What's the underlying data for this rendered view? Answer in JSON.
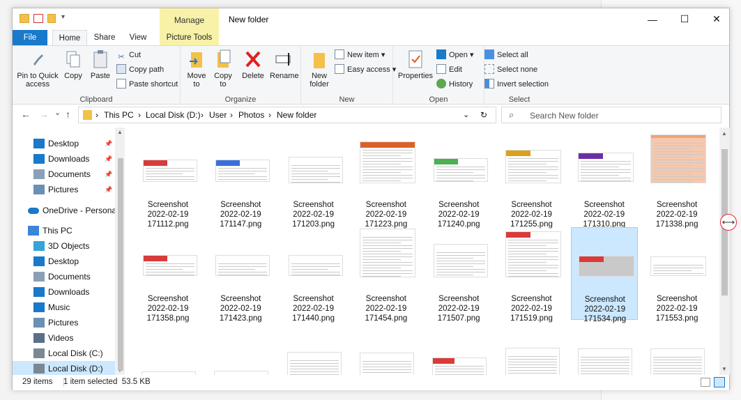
{
  "window": {
    "title": "New folder",
    "context_tab_group": "Manage",
    "minimize_glyph": "—",
    "maximize_glyph": "☐",
    "close_glyph": "✕"
  },
  "tabs": {
    "file": "File",
    "home": "Home",
    "share": "Share",
    "view": "View",
    "picture_tools": "Picture Tools"
  },
  "ribbon": {
    "clipboard": {
      "pin": "Pin to Quick access",
      "copy": "Copy",
      "paste": "Paste",
      "cut": "Cut",
      "copy_path": "Copy path",
      "paste_shortcut": "Paste shortcut",
      "label": "Clipboard"
    },
    "organize": {
      "move_to": "Move to",
      "copy_to": "Copy to",
      "delete": "Delete",
      "rename": "Rename",
      "label": "Organize"
    },
    "new": {
      "new_folder": "New folder",
      "new_item": "New item",
      "easy_access": "Easy access",
      "label": "New"
    },
    "open": {
      "properties": "Properties",
      "open": "Open",
      "edit": "Edit",
      "history": "History",
      "label": "Open"
    },
    "select": {
      "select_all": "Select all",
      "select_none": "Select none",
      "invert": "Invert selection",
      "label": "Select"
    }
  },
  "address": {
    "crumbs": [
      "This PC",
      "Local Disk (D:)",
      "User",
      "Photos",
      "New folder"
    ],
    "search_placeholder": "Search New folder"
  },
  "nav": {
    "items": [
      {
        "label": "Desktop",
        "icon": "desktop-icon",
        "pinned": true
      },
      {
        "label": "Downloads",
        "icon": "downloads-icon",
        "pinned": true
      },
      {
        "label": "Documents",
        "icon": "documents-icon",
        "pinned": true
      },
      {
        "label": "Pictures",
        "icon": "pictures-icon",
        "pinned": true
      },
      {
        "label": "OneDrive - Personal",
        "icon": "onedrive-icon",
        "pinned": false
      },
      {
        "label": "This PC",
        "icon": "this-pc-icon",
        "pinned": false
      },
      {
        "label": "3D Objects",
        "icon": "3d-objects-icon",
        "pinned": false
      },
      {
        "label": "Desktop",
        "icon": "desktop-icon",
        "pinned": false
      },
      {
        "label": "Documents",
        "icon": "documents-icon",
        "pinned": false
      },
      {
        "label": "Downloads",
        "icon": "downloads-icon",
        "pinned": false
      },
      {
        "label": "Music",
        "icon": "music-icon",
        "pinned": false
      },
      {
        "label": "Pictures",
        "icon": "pictures-icon",
        "pinned": false
      },
      {
        "label": "Videos",
        "icon": "videos-icon",
        "pinned": false
      },
      {
        "label": "Local Disk (C:)",
        "icon": "drive-icon",
        "pinned": false
      },
      {
        "label": "Local Disk (D:)",
        "icon": "drive-icon",
        "pinned": false,
        "selected": true
      }
    ]
  },
  "files": [
    {
      "name": "Screenshot",
      "date": "2022-02-19",
      "time": "171112.png",
      "accent": "#d93a3a"
    },
    {
      "name": "Screenshot",
      "date": "2022-02-19",
      "time": "171147.png",
      "accent": "#3a6fd9"
    },
    {
      "name": "Screenshot",
      "date": "2022-02-19",
      "time": "171203.png",
      "accent": ""
    },
    {
      "name": "Screenshot",
      "date": "2022-02-19",
      "time": "171223.png",
      "accent": "#d9622a"
    },
    {
      "name": "Screenshot",
      "date": "2022-02-19",
      "time": "171240.png",
      "accent": "#4caf50"
    },
    {
      "name": "Screenshot",
      "date": "2022-02-19",
      "time": "171255.png",
      "accent": "#d9a21a"
    },
    {
      "name": "Screenshot",
      "date": "2022-02-19",
      "time": "171310.png",
      "accent": "#6a2fa8"
    },
    {
      "name": "Screenshot",
      "date": "2022-02-19",
      "time": "171338.png",
      "accent": "#f0a276"
    },
    {
      "name": "Screenshot",
      "date": "2022-02-19",
      "time": "171358.png",
      "accent": "#d93a3a"
    },
    {
      "name": "Screenshot",
      "date": "2022-02-19",
      "time": "171423.png",
      "accent": ""
    },
    {
      "name": "Screenshot",
      "date": "2022-02-19",
      "time": "171440.png",
      "accent": ""
    },
    {
      "name": "Screenshot",
      "date": "2022-02-19",
      "time": "171454.png",
      "accent": ""
    },
    {
      "name": "Screenshot",
      "date": "2022-02-19",
      "time": "171507.png",
      "accent": ""
    },
    {
      "name": "Screenshot",
      "date": "2022-02-19",
      "time": "171519.png",
      "accent": "#d93a3a"
    },
    {
      "name": "Screenshot",
      "date": "2022-02-19",
      "time": "171534.png",
      "accent": "#d93a3a",
      "selected": true
    },
    {
      "name": "Screenshot",
      "date": "2022-02-19",
      "time": "171553.png",
      "accent": ""
    }
  ],
  "partial_row_count": 8,
  "status": {
    "count": "29 items",
    "selected": "1 item selected  53.5 KB"
  },
  "icons": {
    "back": "←",
    "forward": "→",
    "recent": "⌄",
    "up": "↑",
    "refresh": "↻",
    "search": "⌕",
    "help": "?",
    "resize": "⟷"
  }
}
